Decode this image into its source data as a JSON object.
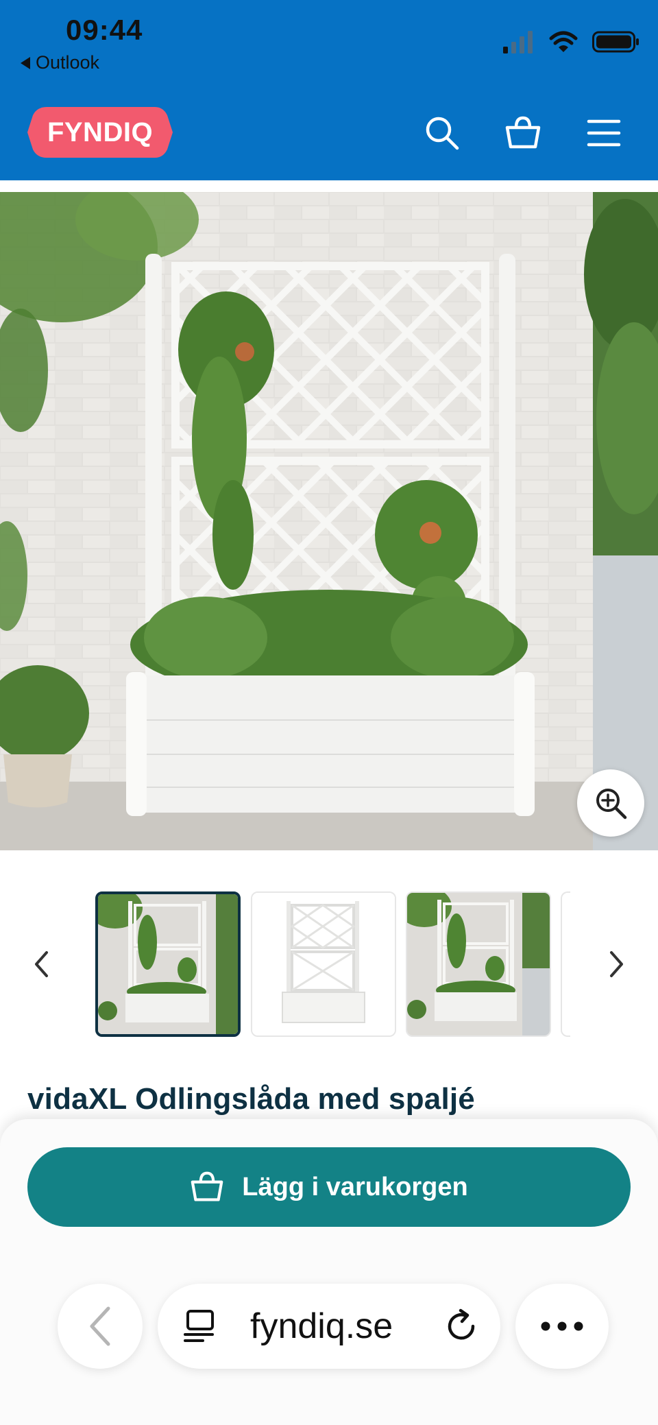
{
  "status_bar": {
    "time": "09:44",
    "back_app": "Outlook"
  },
  "site": {
    "logo_text": "FYNDIQ",
    "brand_color": "#0672c4",
    "logo_color": "#f25a6e",
    "icons": [
      "search-icon",
      "cart-icon",
      "menu-icon"
    ]
  },
  "product": {
    "title": "vidaXL Odlingslåda med spaljé",
    "thumbnails_count": 4,
    "active_thumbnail": 1
  },
  "actions": {
    "add_to_cart": "Lägg i varukorgen",
    "button_color": "#138286"
  },
  "browser": {
    "url": "fyndiq.se"
  }
}
